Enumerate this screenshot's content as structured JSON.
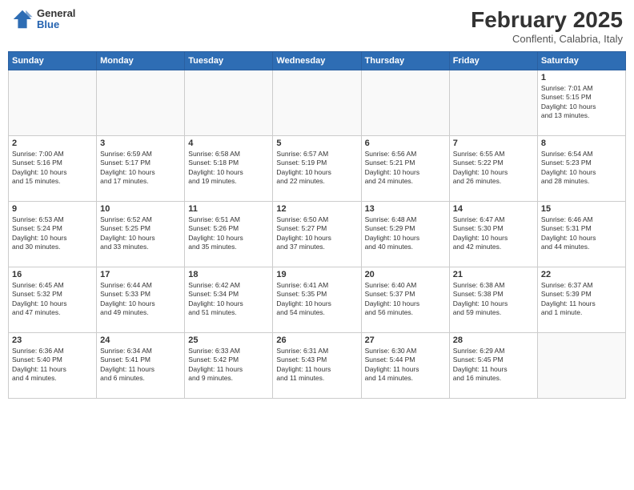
{
  "header": {
    "logo": {
      "general": "General",
      "blue": "Blue"
    },
    "month": "February 2025",
    "location": "Conflenti, Calabria, Italy"
  },
  "weekdays": [
    "Sunday",
    "Monday",
    "Tuesday",
    "Wednesday",
    "Thursday",
    "Friday",
    "Saturday"
  ],
  "weeks": [
    [
      {
        "day": "",
        "info": ""
      },
      {
        "day": "",
        "info": ""
      },
      {
        "day": "",
        "info": ""
      },
      {
        "day": "",
        "info": ""
      },
      {
        "day": "",
        "info": ""
      },
      {
        "day": "",
        "info": ""
      },
      {
        "day": "1",
        "info": "Sunrise: 7:01 AM\nSunset: 5:15 PM\nDaylight: 10 hours\nand 13 minutes."
      }
    ],
    [
      {
        "day": "2",
        "info": "Sunrise: 7:00 AM\nSunset: 5:16 PM\nDaylight: 10 hours\nand 15 minutes."
      },
      {
        "day": "3",
        "info": "Sunrise: 6:59 AM\nSunset: 5:17 PM\nDaylight: 10 hours\nand 17 minutes."
      },
      {
        "day": "4",
        "info": "Sunrise: 6:58 AM\nSunset: 5:18 PM\nDaylight: 10 hours\nand 19 minutes."
      },
      {
        "day": "5",
        "info": "Sunrise: 6:57 AM\nSunset: 5:19 PM\nDaylight: 10 hours\nand 22 minutes."
      },
      {
        "day": "6",
        "info": "Sunrise: 6:56 AM\nSunset: 5:21 PM\nDaylight: 10 hours\nand 24 minutes."
      },
      {
        "day": "7",
        "info": "Sunrise: 6:55 AM\nSunset: 5:22 PM\nDaylight: 10 hours\nand 26 minutes."
      },
      {
        "day": "8",
        "info": "Sunrise: 6:54 AM\nSunset: 5:23 PM\nDaylight: 10 hours\nand 28 minutes."
      }
    ],
    [
      {
        "day": "9",
        "info": "Sunrise: 6:53 AM\nSunset: 5:24 PM\nDaylight: 10 hours\nand 30 minutes."
      },
      {
        "day": "10",
        "info": "Sunrise: 6:52 AM\nSunset: 5:25 PM\nDaylight: 10 hours\nand 33 minutes."
      },
      {
        "day": "11",
        "info": "Sunrise: 6:51 AM\nSunset: 5:26 PM\nDaylight: 10 hours\nand 35 minutes."
      },
      {
        "day": "12",
        "info": "Sunrise: 6:50 AM\nSunset: 5:27 PM\nDaylight: 10 hours\nand 37 minutes."
      },
      {
        "day": "13",
        "info": "Sunrise: 6:48 AM\nSunset: 5:29 PM\nDaylight: 10 hours\nand 40 minutes."
      },
      {
        "day": "14",
        "info": "Sunrise: 6:47 AM\nSunset: 5:30 PM\nDaylight: 10 hours\nand 42 minutes."
      },
      {
        "day": "15",
        "info": "Sunrise: 6:46 AM\nSunset: 5:31 PM\nDaylight: 10 hours\nand 44 minutes."
      }
    ],
    [
      {
        "day": "16",
        "info": "Sunrise: 6:45 AM\nSunset: 5:32 PM\nDaylight: 10 hours\nand 47 minutes."
      },
      {
        "day": "17",
        "info": "Sunrise: 6:44 AM\nSunset: 5:33 PM\nDaylight: 10 hours\nand 49 minutes."
      },
      {
        "day": "18",
        "info": "Sunrise: 6:42 AM\nSunset: 5:34 PM\nDaylight: 10 hours\nand 51 minutes."
      },
      {
        "day": "19",
        "info": "Sunrise: 6:41 AM\nSunset: 5:35 PM\nDaylight: 10 hours\nand 54 minutes."
      },
      {
        "day": "20",
        "info": "Sunrise: 6:40 AM\nSunset: 5:37 PM\nDaylight: 10 hours\nand 56 minutes."
      },
      {
        "day": "21",
        "info": "Sunrise: 6:38 AM\nSunset: 5:38 PM\nDaylight: 10 hours\nand 59 minutes."
      },
      {
        "day": "22",
        "info": "Sunrise: 6:37 AM\nSunset: 5:39 PM\nDaylight: 11 hours\nand 1 minute."
      }
    ],
    [
      {
        "day": "23",
        "info": "Sunrise: 6:36 AM\nSunset: 5:40 PM\nDaylight: 11 hours\nand 4 minutes."
      },
      {
        "day": "24",
        "info": "Sunrise: 6:34 AM\nSunset: 5:41 PM\nDaylight: 11 hours\nand 6 minutes."
      },
      {
        "day": "25",
        "info": "Sunrise: 6:33 AM\nSunset: 5:42 PM\nDaylight: 11 hours\nand 9 minutes."
      },
      {
        "day": "26",
        "info": "Sunrise: 6:31 AM\nSunset: 5:43 PM\nDaylight: 11 hours\nand 11 minutes."
      },
      {
        "day": "27",
        "info": "Sunrise: 6:30 AM\nSunset: 5:44 PM\nDaylight: 11 hours\nand 14 minutes."
      },
      {
        "day": "28",
        "info": "Sunrise: 6:29 AM\nSunset: 5:45 PM\nDaylight: 11 hours\nand 16 minutes."
      },
      {
        "day": "",
        "info": ""
      }
    ]
  ]
}
